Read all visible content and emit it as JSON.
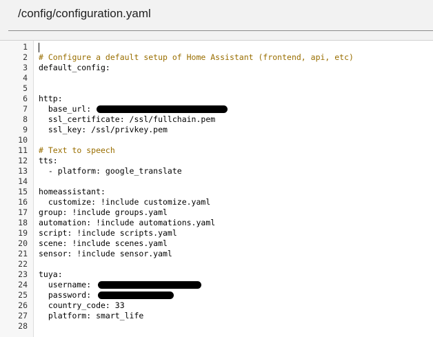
{
  "header": {
    "title": "/config/configuration.yaml"
  },
  "editor": {
    "lines": [
      {
        "n": "1",
        "text": ""
      },
      {
        "n": "2",
        "text": "# Configure a default setup of Home Assistant (frontend, api, etc)"
      },
      {
        "n": "3",
        "text": "default_config:"
      },
      {
        "n": "4",
        "text": ""
      },
      {
        "n": "5",
        "text": ""
      },
      {
        "n": "6",
        "text": "http:"
      },
      {
        "n": "7",
        "text": "  base_url: "
      },
      {
        "n": "8",
        "text": "  ssl_certificate: /ssl/fullchain.pem"
      },
      {
        "n": "9",
        "text": "  ssl_key: /ssl/privkey.pem"
      },
      {
        "n": "10",
        "text": ""
      },
      {
        "n": "11",
        "text": "# Text to speech"
      },
      {
        "n": "12",
        "text": "tts:"
      },
      {
        "n": "13",
        "text": "  - platform: google_translate"
      },
      {
        "n": "14",
        "text": ""
      },
      {
        "n": "15",
        "text": "homeassistant:"
      },
      {
        "n": "16",
        "text": "  customize: !include customize.yaml"
      },
      {
        "n": "17",
        "text": "group: !include groups.yaml"
      },
      {
        "n": "18",
        "text": "automation: !include automations.yaml"
      },
      {
        "n": "19",
        "text": "script: !include scripts.yaml"
      },
      {
        "n": "20",
        "text": "scene: !include scenes.yaml"
      },
      {
        "n": "21",
        "text": "sensor: !include sensor.yaml"
      },
      {
        "n": "22",
        "text": ""
      },
      {
        "n": "23",
        "text": "tuya:"
      },
      {
        "n": "24",
        "text": "  username: "
      },
      {
        "n": "25",
        "text": "  password: "
      },
      {
        "n": "26",
        "text": "  country_code: 33"
      },
      {
        "n": "27",
        "text": "  platform: smart_life"
      },
      {
        "n": "28",
        "text": ""
      }
    ]
  },
  "colors": {
    "comment": "#996e00",
    "gutter_bg": "#f7f7f7",
    "header_bg": "#f2f2f2"
  }
}
